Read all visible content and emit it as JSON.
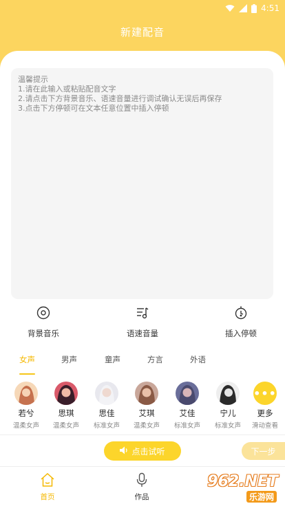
{
  "status": {
    "time": "4:51"
  },
  "header": {
    "title": "新建配音"
  },
  "editor": {
    "placeholder": "温馨提示\n1.请在此输入或粘贴配音文字\n2.请点击下方背景音乐、语速音量进行调试确认无误后再保存\n3.点击下方停顿可在文本任意位置中插入停顿"
  },
  "tools": [
    {
      "label": "背景音乐",
      "icon": "music-disc-icon"
    },
    {
      "label": "语速音量",
      "icon": "tempo-icon"
    },
    {
      "label": "插入停顿",
      "icon": "pause-insert-icon"
    }
  ],
  "tabs": [
    {
      "label": "女声",
      "active": true
    },
    {
      "label": "男声",
      "active": false
    },
    {
      "label": "童声",
      "active": false
    },
    {
      "label": "方言",
      "active": false
    },
    {
      "label": "外语",
      "active": false
    }
  ],
  "voices": [
    {
      "name": "若兮",
      "desc": "温柔女声"
    },
    {
      "name": "思琪",
      "desc": "温柔女声"
    },
    {
      "name": "思佳",
      "desc": "标准女声"
    },
    {
      "name": "艾琪",
      "desc": "温柔女声"
    },
    {
      "name": "艾佳",
      "desc": "标准女声"
    },
    {
      "name": "宁儿",
      "desc": "标准女声"
    },
    {
      "name": "更多",
      "desc": "滑动查看"
    }
  ],
  "actions": {
    "listen": "点击试听",
    "next": "下一步"
  },
  "nav": [
    {
      "label": "首页",
      "active": true
    },
    {
      "label": "作品",
      "active": false
    }
  ],
  "watermark": {
    "brand": "962.NET",
    "sub": "乐游网"
  },
  "colors": {
    "accent": "#fcd55f",
    "button": "#fcd52b",
    "active_tab": "#f5b800"
  }
}
